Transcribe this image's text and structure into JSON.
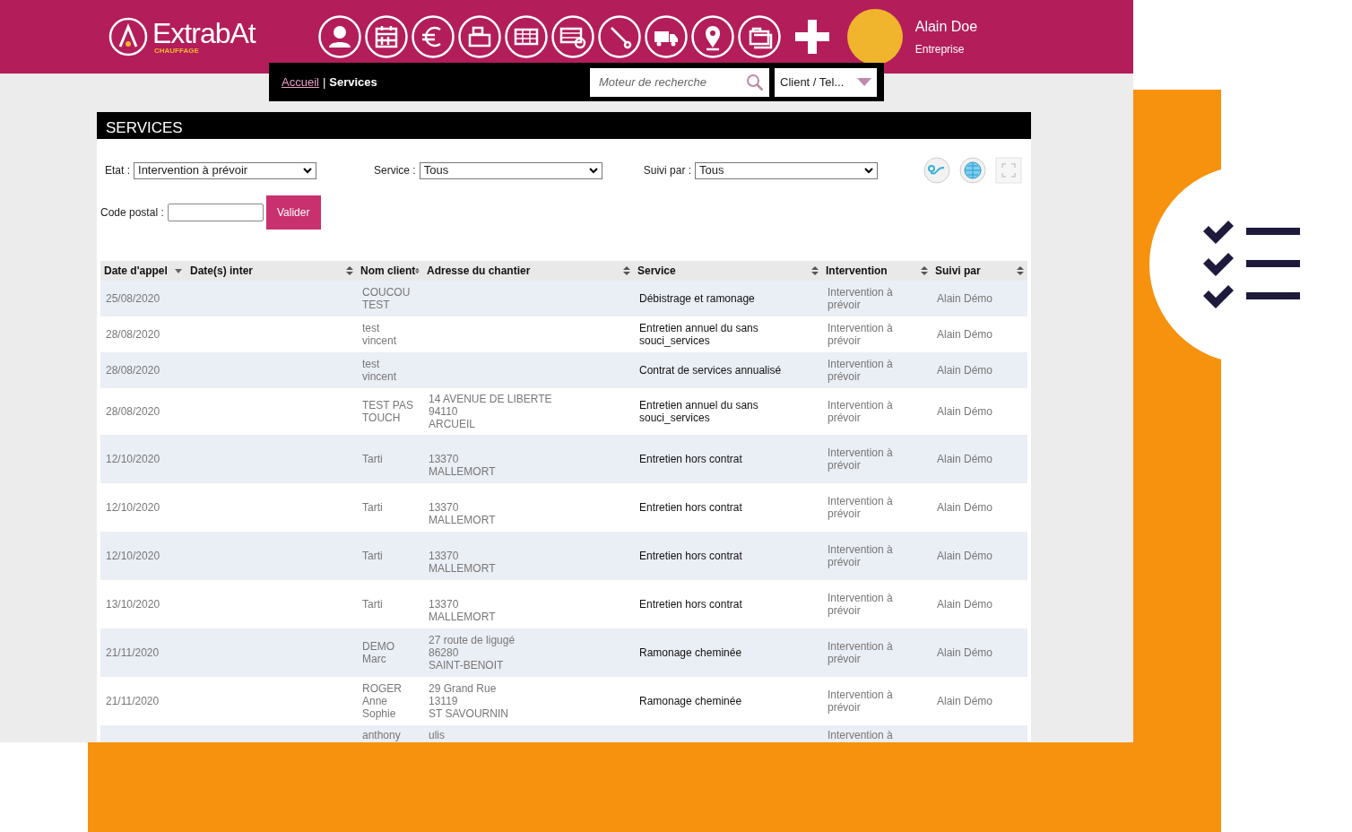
{
  "header": {
    "logo": {
      "name": "ExtrabAt",
      "tagline": "CHAUFFAGE"
    },
    "user": {
      "name": "Alain Doe",
      "role": "Entreprise"
    }
  },
  "breadcrumb": {
    "items": [
      "Accueil",
      "Services"
    ],
    "separator": "|"
  },
  "search": {
    "placeholder": "Moteur de recherche",
    "scope": "Client / Tel..."
  },
  "panel": {
    "title": "SERVICES"
  },
  "filters": [
    {
      "label": "Etat :",
      "value": "Intervention à prévoir"
    },
    {
      "label": "Service :",
      "value": "Tous"
    },
    {
      "label": "Suivi par :",
      "value": "Tous"
    }
  ],
  "postal": {
    "label": "Code postal :",
    "button": "Valider"
  },
  "table": {
    "columns": [
      {
        "label": "Date d'appel",
        "sorted": true
      },
      {
        "label": "Date(s) inter",
        "sorted": false
      },
      {
        "label": "Nom client",
        "sorted": false
      },
      {
        "label": "Adresse du chantier",
        "sorted": false
      },
      {
        "label": "Service",
        "sorted": false
      },
      {
        "label": "Intervention",
        "sorted": false
      },
      {
        "label": "Suivi par",
        "sorted": false
      }
    ],
    "rows": [
      {
        "date": "25/08/2020",
        "client": "COUCOU\nTEST",
        "address": "",
        "service": "Débistrage et ramonage",
        "intervention": "Intervention à\nprévoir",
        "followed_by": "Alain Démo"
      },
      {
        "date": "28/08/2020",
        "client": "test\nvincent",
        "address": "",
        "service": "Entretien annuel du sans\nsouci_services",
        "intervention": "Intervention à\nprévoir",
        "followed_by": "Alain Démo"
      },
      {
        "date": "28/08/2020",
        "client": "test\nvincent",
        "address": "",
        "service": "Contrat de services annualisé",
        "intervention": "Intervention à\nprévoir",
        "followed_by": "Alain Démo"
      },
      {
        "date": "28/08/2020",
        "client": "TEST PAS\nTOUCH",
        "address": "14 AVENUE DE LIBERTE\n94110\nARCUEIL",
        "service": "Entretien annuel du sans\nsouci_services",
        "intervention": "Intervention à\nprévoir",
        "followed_by": "Alain Démo"
      },
      {
        "date": "12/10/2020",
        "client": "Tarti",
        "address": "\n13370\nMALLEMORT",
        "service": "Entretien hors contrat",
        "intervention": "Intervention à\nprévoir",
        "followed_by": "Alain Démo"
      },
      {
        "date": "12/10/2020",
        "client": "Tarti",
        "address": "\n13370\nMALLEMORT",
        "service": "Entretien hors contrat",
        "intervention": "Intervention à\nprévoir",
        "followed_by": "Alain Démo"
      },
      {
        "date": "12/10/2020",
        "client": "Tarti",
        "address": "\n13370\nMALLEMORT",
        "service": "Entretien hors contrat",
        "intervention": "Intervention à\nprévoir",
        "followed_by": "Alain Démo"
      },
      {
        "date": "13/10/2020",
        "client": "Tarti",
        "address": "\n13370\nMALLEMORT",
        "service": "Entretien hors contrat",
        "intervention": "Intervention à\nprévoir",
        "followed_by": "Alain Démo"
      },
      {
        "date": "21/11/2020",
        "client": "DEMO\nMarc",
        "address": "27 route de ligugé\n86280\nSAINT-BENOIT",
        "service": "Ramonage cheminée",
        "intervention": "Intervention à\nprévoir",
        "followed_by": "Alain Démo"
      },
      {
        "date": "21/11/2020",
        "client": "ROGER\nAnne\nSophie",
        "address": "29 Grand Rue\n13119\nST SAVOURNIN",
        "service": "Ramonage cheminée",
        "intervention": "Intervention à\nprévoir",
        "followed_by": "Alain Démo"
      },
      {
        "date": "",
        "client": "anthony",
        "address": "ulis",
        "service": "",
        "intervention": "Intervention à",
        "followed_by": ""
      }
    ]
  }
}
